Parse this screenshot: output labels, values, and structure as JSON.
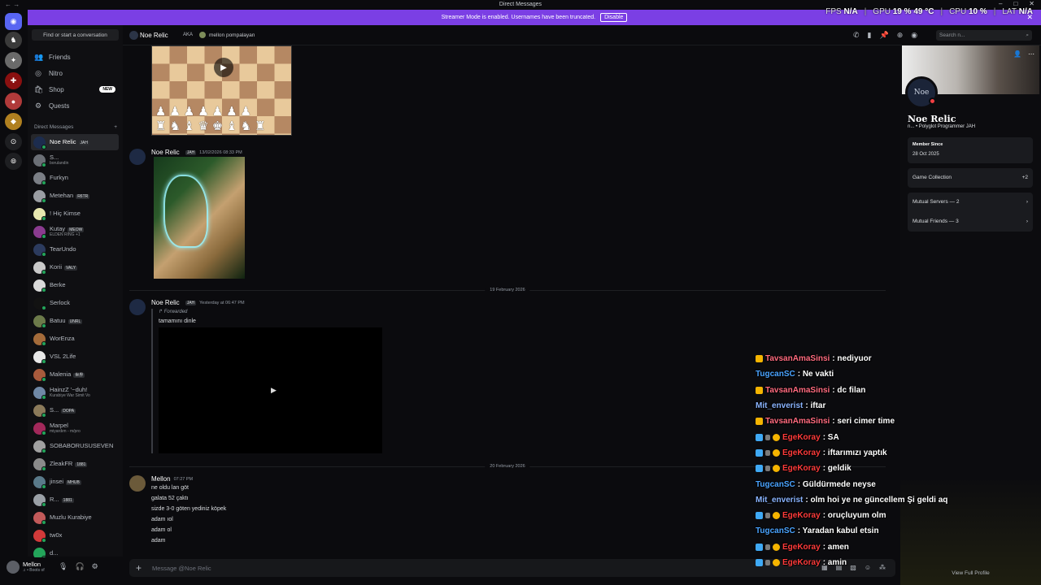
{
  "titlebar": {
    "title": "Direct Messages"
  },
  "banner": {
    "text": "Streamer Mode is enabled. Usernames have been truncated.",
    "disable_label": "Disable"
  },
  "overlay": {
    "fps_label": "FPS",
    "fps": "N/A",
    "gpu_label": "GPU",
    "gpu": "19 %  49 °C",
    "cpu_label": "CPU",
    "cpu": "10 %",
    "lat_label": "LAT",
    "lat": "N/A"
  },
  "sidebar": {
    "find_label": "Find or start a conversation",
    "nav": [
      {
        "label": "Friends"
      },
      {
        "label": "Nitro"
      },
      {
        "label": "Shop",
        "badge": "NEW"
      },
      {
        "label": "Quests"
      }
    ],
    "dm_header": "Direct Messages",
    "dms": [
      {
        "name": "Noe Relic",
        "tag": "JAH",
        "sub": "",
        "color": "#1c2c4e",
        "active": true
      },
      {
        "name": "S...",
        "tag": "",
        "sub": "borulandin",
        "color": "#6b6f76"
      },
      {
        "name": "Furkyn",
        "tag": "",
        "sub": "",
        "color": "#7b7f86"
      },
      {
        "name": "Metehan",
        "tag": "R6TR",
        "sub": "",
        "color": "#9a9da3"
      },
      {
        "name": "! Hiç Kimse",
        "tag": "",
        "sub": "",
        "color": "#e8e8b0"
      },
      {
        "name": "Kutay",
        "tag": "MEOW",
        "sub": "ELDEN RING +1",
        "color": "#8a3b8f"
      },
      {
        "name": "TearUndo",
        "tag": "",
        "sub": "",
        "color": "#2c3b5e"
      },
      {
        "name": "Korii",
        "tag": "VALY",
        "sub": "",
        "color": "#c9c9c9"
      },
      {
        "name": "Berke",
        "tag": "",
        "sub": "",
        "color": "#d9d9d9"
      },
      {
        "name": "Serlock",
        "tag": "",
        "sub": "",
        "color": "#121212"
      },
      {
        "name": "Batuu",
        "tag": "UNRL",
        "sub": "",
        "color": "#6c7a4a"
      },
      {
        "name": "WorEnza",
        "tag": "",
        "sub": "",
        "color": "#a46b3a"
      },
      {
        "name": "VSL 2Life",
        "tag": "",
        "sub": "",
        "color": "#e8e8e8"
      },
      {
        "name": "Malenia",
        "tag": "世界",
        "sub": "",
        "color": "#a85a3c"
      },
      {
        "name": "HainzZ '~duh!",
        "tag": "",
        "sub": "Kurabiye War Simit Vo",
        "color": "#6f88a6"
      },
      {
        "name": "S...",
        "tag": "DOPA",
        "sub": "",
        "color": "#8b7a5a"
      },
      {
        "name": "Marpel",
        "tag": "",
        "sub": "miyardım - m/pro",
        "color": "#a2285a"
      },
      {
        "name": "SOBABORUSUSEVEN",
        "tag": "",
        "sub": "",
        "color": "#a0a0a0"
      },
      {
        "name": "ZleakFR",
        "tag": "1881",
        "sub": "",
        "color": "#8a8a8a"
      },
      {
        "name": "jinsei",
        "tag": "MHUB",
        "sub": "",
        "color": "#5a7a8a"
      },
      {
        "name": "R...",
        "tag": "1881",
        "sub": "",
        "color": "#9aa0a6"
      },
      {
        "name": "Muzlu Kurabiye",
        "tag": "",
        "sub": "",
        "color": "#c25a5a"
      },
      {
        "name": "tw0x",
        "tag": "",
        "sub": "",
        "color": "#d23a3a"
      },
      {
        "name": "d...",
        "tag": "",
        "sub": "",
        "color": "#23a55a"
      }
    ]
  },
  "user": {
    "name": "Mellon",
    "status": "♫ • Boots of"
  },
  "header": {
    "name": "Noe Relic",
    "aka": "AKA",
    "aka_name": "mellon pompalayan",
    "search_placeholder": "Search n..."
  },
  "chat": {
    "msg1": {
      "author": "Noe Relic",
      "tag": "JAH",
      "time": "13/02/2026 08:33 PM"
    },
    "divider1": "19 February 2026",
    "msg2": {
      "author": "Noe Relic",
      "tag": "JAH",
      "time": "Yesterday at 06:47 PM",
      "forwarded": "Forwarded",
      "text": "tamamını dinle"
    },
    "divider2": "20 February 2026",
    "msg3": {
      "author": "Mellon",
      "time": "07:27 PM",
      "lines": [
        "ne oldu lan göt",
        "galata 52 çaktı",
        "sizde 3-0 göten yediniz köpek",
        "adam ıol",
        "adam ol",
        "adam"
      ]
    }
  },
  "composer": {
    "placeholder": "Message @Noe Relic"
  },
  "profile": {
    "name": "Noe Relic",
    "sub": "n... • Polyglot Programmer  JAH",
    "member_since_label": "Member Since",
    "member_since": "28 Oct 2025",
    "game_collection_label": "Game Collection",
    "game_collection_extra": "+2",
    "mutual_servers": "Mutual Servers — 2",
    "mutual_friends": "Mutual Friends — 3",
    "view_full": "View Full Profile"
  },
  "twitch_chat": [
    {
      "user": "TavsanAmaSinsi",
      "msg": ": nediyuor",
      "color": "#ff6b7f",
      "badges": [
        "gold"
      ]
    },
    {
      "user": "TugcanSC",
      "msg": ": Ne vakti",
      "color": "#4aa3ff",
      "badges": []
    },
    {
      "user": "TavsanAmaSinsi",
      "msg": ": dc filan",
      "color": "#ff6b7f",
      "badges": [
        "gold"
      ]
    },
    {
      "user": "Mit_enverist",
      "msg": ": iftar",
      "color": "#8ab4ff",
      "badges": []
    },
    {
      "user": "TavsanAmaSinsi",
      "msg": ": seri cimer time",
      "color": "#ff6b7f",
      "badges": [
        "gold"
      ]
    },
    {
      "user": "EgeKoray",
      "msg": ": SA",
      "color": "#ff3b3b",
      "badges": [
        "blue",
        "sw",
        "circ"
      ]
    },
    {
      "user": "EgeKoray",
      "msg": ": iftarımızı yaptık",
      "color": "#ff3b3b",
      "badges": [
        "blue",
        "sw",
        "circ"
      ]
    },
    {
      "user": "EgeKoray",
      "msg": ": geldik",
      "color": "#ff3b3b",
      "badges": [
        "blue",
        "sw",
        "circ"
      ]
    },
    {
      "user": "TugcanSC",
      "msg": ": Güldürmede neyse",
      "color": "#4aa3ff",
      "badges": []
    },
    {
      "user": "Mit_enverist",
      "msg": ": olm hoi ye ne güncellem Şi geldi aq",
      "color": "#8ab4ff",
      "badges": []
    },
    {
      "user": "EgeKoray",
      "msg": ": oruçluyum olm",
      "color": "#ff3b3b",
      "badges": [
        "blue",
        "sw",
        "circ"
      ]
    },
    {
      "user": "TugcanSC",
      "msg": ": Yaradan kabul etsin",
      "color": "#4aa3ff",
      "badges": []
    },
    {
      "user": "EgeKoray",
      "msg": ": amen",
      "color": "#ff3b3b",
      "badges": [
        "blue",
        "sw",
        "circ"
      ]
    },
    {
      "user": "EgeKoray",
      "msg": ": amin",
      "color": "#ff3b3b",
      "badges": [
        "blue",
        "sw",
        "circ"
      ]
    }
  ]
}
